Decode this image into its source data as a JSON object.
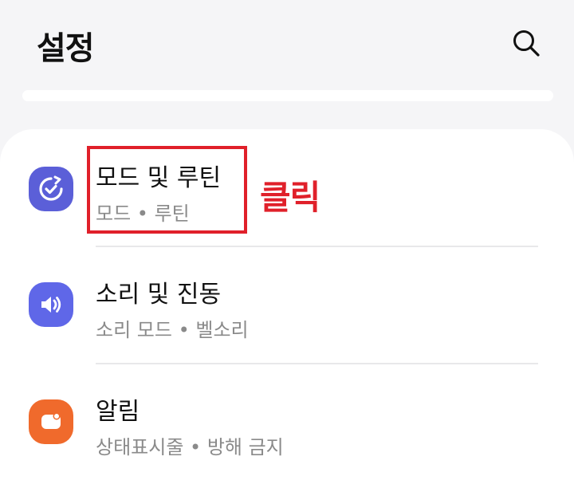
{
  "header": {
    "title": "설정",
    "search_icon": "search-icon"
  },
  "settings": [
    {
      "title": "모드 및 루틴",
      "subtitle": "모드 • 루틴",
      "icon": "modes-routines-check-icon",
      "icon_color": "#5b5fd8"
    },
    {
      "title": "소리 및 진동",
      "subtitle": "소리 모드 • 벨소리",
      "icon": "speaker-icon",
      "icon_color": "#5f67e8"
    },
    {
      "title": "알림",
      "subtitle": "상태표시줄 • 방해 금지",
      "icon": "notification-icon",
      "icon_color": "#f06a2c"
    }
  ],
  "annotation": {
    "text": "클릭",
    "color": "#e0202a"
  },
  "colors": {
    "background": "#f5f5f7",
    "card": "#ffffff"
  }
}
